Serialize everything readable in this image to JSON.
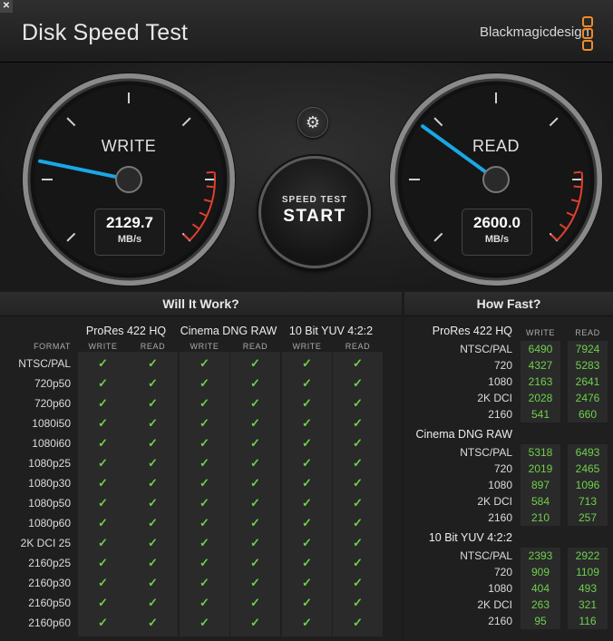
{
  "app": {
    "title": "Disk Speed Test",
    "brand": "Blackmagicdesign",
    "close_symbol": "✕"
  },
  "gauges": {
    "write": {
      "label": "WRITE",
      "value": "2129.7",
      "unit": "MB/s",
      "needle_fraction": 0.21
    },
    "read": {
      "label": "READ",
      "value": "2600.0",
      "unit": "MB/s",
      "needle_fraction": 0.3
    }
  },
  "controls": {
    "settings_icon": "gear-icon",
    "start_sub": "SPEED TEST",
    "start_main": "START"
  },
  "colors": {
    "accent": "#19a8e6",
    "check": "#6fd04d",
    "redline": "#e0402f",
    "brand": "#f08a2a"
  },
  "will_it_work": {
    "title": "Will It Work?",
    "format_header": "FORMAT",
    "categories": [
      "ProRes 422 HQ",
      "Cinema DNG RAW",
      "10 Bit YUV 4:2:2"
    ],
    "sub_headers": [
      "WRITE",
      "READ"
    ],
    "formats": [
      "NTSC/PAL",
      "720p50",
      "720p60",
      "1080i50",
      "1080i60",
      "1080p25",
      "1080p30",
      "1080p50",
      "1080p60",
      "2K DCI 25",
      "2160p25",
      "2160p30",
      "2160p50",
      "2160p60"
    ],
    "check": "✓"
  },
  "how_fast": {
    "title": "How Fast?",
    "sub_headers": [
      "WRITE",
      "READ"
    ],
    "groups": [
      {
        "name": "ProRes 422 HQ",
        "rows": [
          {
            "label": "NTSC/PAL",
            "write": "6490",
            "read": "7924"
          },
          {
            "label": "720",
            "write": "4327",
            "read": "5283"
          },
          {
            "label": "1080",
            "write": "2163",
            "read": "2641"
          },
          {
            "label": "2K DCI",
            "write": "2028",
            "read": "2476"
          },
          {
            "label": "2160",
            "write": "541",
            "read": "660"
          }
        ]
      },
      {
        "name": "Cinema DNG RAW",
        "rows": [
          {
            "label": "NTSC/PAL",
            "write": "5318",
            "read": "6493"
          },
          {
            "label": "720",
            "write": "2019",
            "read": "2465"
          },
          {
            "label": "1080",
            "write": "897",
            "read": "1096"
          },
          {
            "label": "2K DCI",
            "write": "584",
            "read": "713"
          },
          {
            "label": "2160",
            "write": "210",
            "read": "257"
          }
        ]
      },
      {
        "name": "10 Bit YUV 4:2:2",
        "rows": [
          {
            "label": "NTSC/PAL",
            "write": "2393",
            "read": "2922"
          },
          {
            "label": "720",
            "write": "909",
            "read": "1109"
          },
          {
            "label": "1080",
            "write": "404",
            "read": "493"
          },
          {
            "label": "2K DCI",
            "write": "263",
            "read": "321"
          },
          {
            "label": "2160",
            "write": "95",
            "read": "116"
          }
        ]
      }
    ]
  }
}
